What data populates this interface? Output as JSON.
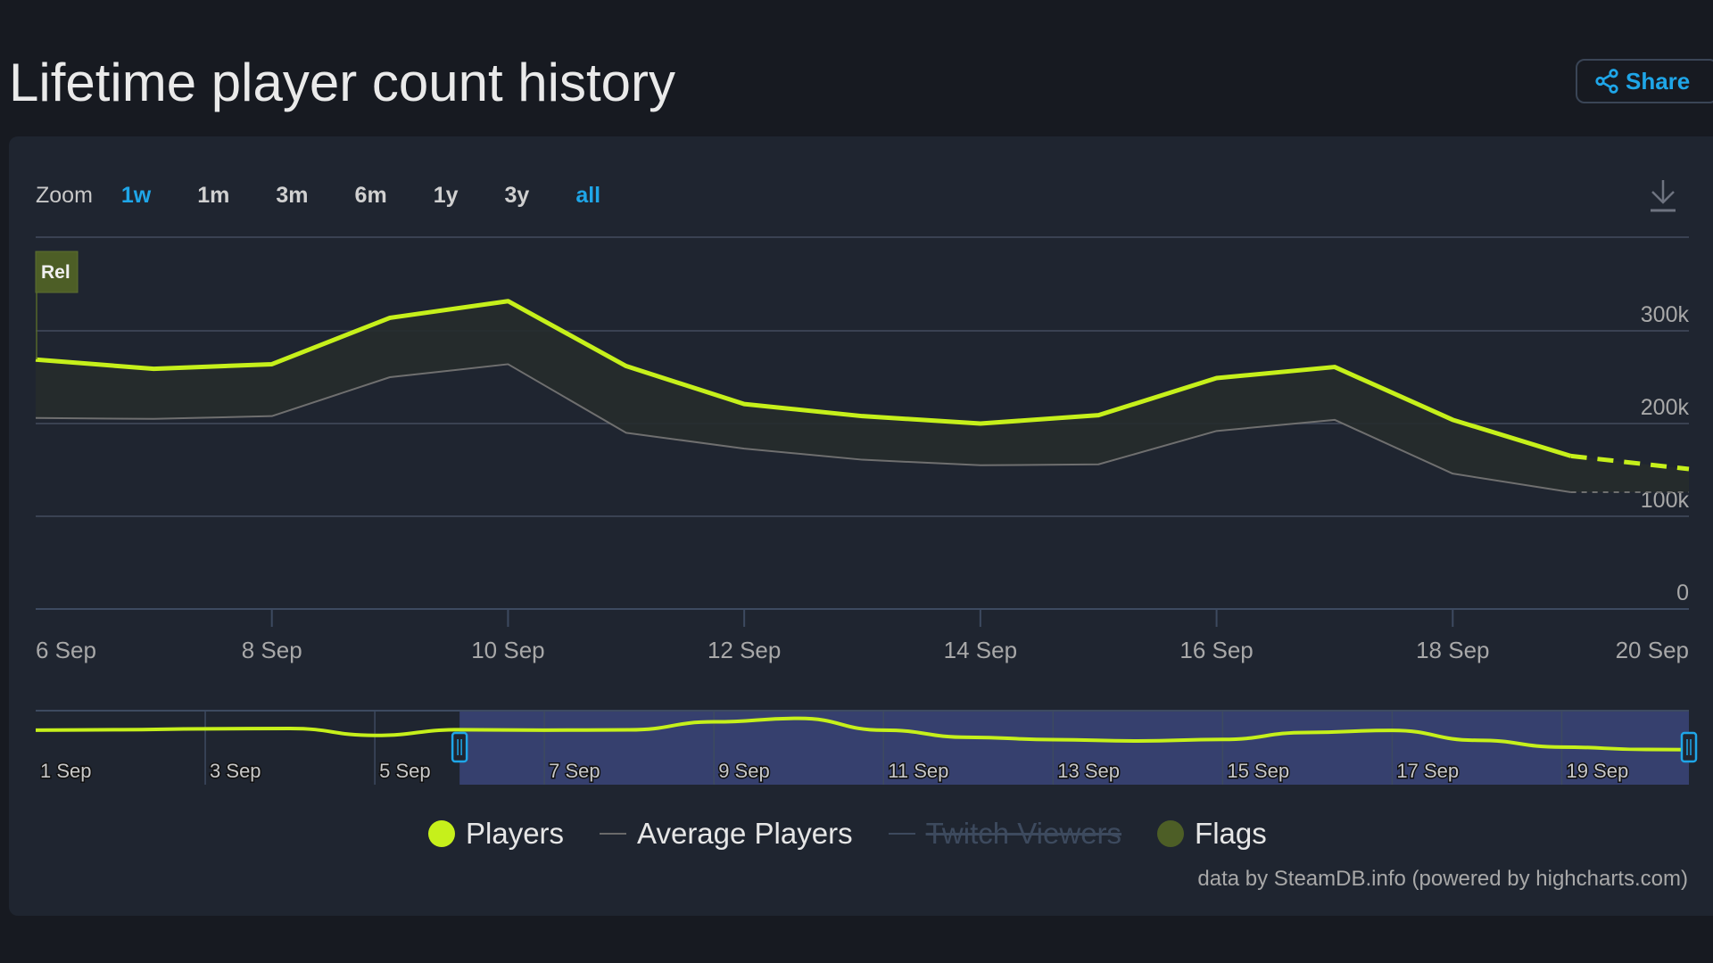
{
  "page": {
    "title": "Lifetime player count history",
    "share_label": "Share"
  },
  "toolbar": {
    "zoom_label": "Zoom",
    "zoom_options": [
      "1w",
      "1m",
      "3m",
      "6m",
      "1y",
      "3y",
      "all"
    ],
    "active_zoom": [
      "1w",
      "all"
    ]
  },
  "flag": {
    "label": "Rel",
    "date": "6 Sep"
  },
  "legend": {
    "items": [
      {
        "label": "Players",
        "symbol": "dot",
        "color": "#c6f01b",
        "hidden": false
      },
      {
        "label": "Average Players",
        "symbol": "line",
        "color": "#8a8a8a",
        "hidden": false
      },
      {
        "label": "Twitch Viewers",
        "symbol": "line",
        "color": "#3d4a5e",
        "hidden": true
      },
      {
        "label": "Flags",
        "symbol": "dot",
        "color": "#4d5e26",
        "hidden": false
      }
    ]
  },
  "credits": "data by SteamDB.info (powered by highcharts.com)",
  "colors": {
    "players": "#c6f01b",
    "average": "#7a7a7a",
    "accent": "#1fa6e8",
    "flag": "#4d5e26",
    "navigator_selection": "#36406e"
  },
  "chart_data": {
    "type": "line",
    "title": "Lifetime player count history",
    "x": [
      "6 Sep",
      "7 Sep",
      "8 Sep",
      "9 Sep",
      "10 Sep",
      "11 Sep",
      "12 Sep",
      "13 Sep",
      "14 Sep",
      "15 Sep",
      "16 Sep",
      "17 Sep",
      "18 Sep",
      "19 Sep",
      "20 Sep"
    ],
    "x_day_index": [
      6,
      7,
      8,
      9,
      10,
      11,
      12,
      13,
      14,
      15,
      16,
      17,
      18,
      19,
      20
    ],
    "series": [
      {
        "name": "Players",
        "values": [
          269000,
          259000,
          264000,
          314000,
          332000,
          262000,
          221000,
          208000,
          200000,
          209000,
          249000,
          261000,
          204000,
          165000,
          151000
        ],
        "dashed_from_index": 13
      },
      {
        "name": "Average Players",
        "values": [
          206000,
          205000,
          208000,
          250000,
          264000,
          190000,
          173000,
          161000,
          155000,
          156000,
          192000,
          204000,
          146000,
          126000,
          126000
        ],
        "dashed_from_index": 13
      }
    ],
    "xtick_labels": [
      "6 Sep",
      "8 Sep",
      "10 Sep",
      "12 Sep",
      "14 Sep",
      "16 Sep",
      "18 Sep",
      "20 Sep"
    ],
    "xtick_days": [
      6,
      8,
      10,
      12,
      14,
      16,
      18,
      20
    ],
    "ytick_labels": [
      "0",
      "100k",
      "200k",
      "300k"
    ],
    "ytick_values": [
      0,
      100000,
      200000,
      300000
    ],
    "ylim": [
      0,
      400000
    ],
    "xlabel": "",
    "ylabel": "",
    "grid": true,
    "legend_position": "bottom-center",
    "navigator": {
      "x_range_days": [
        1,
        20.5
      ],
      "selection_days": [
        6,
        20.5
      ],
      "tick_labels": [
        "1 Sep",
        "3 Sep",
        "5 Sep",
        "7 Sep",
        "9 Sep",
        "11 Sep",
        "13 Sep",
        "15 Sep",
        "17 Sep",
        "19 Sep"
      ],
      "tick_days": [
        1,
        3,
        5,
        7,
        9,
        11,
        13,
        15,
        17,
        19
      ],
      "players_days": [
        1,
        2,
        3,
        4,
        5,
        6,
        7,
        8,
        9,
        10,
        11,
        12,
        13,
        14,
        15,
        16,
        17,
        18,
        19,
        20,
        20.5
      ],
      "players_values": [
        262000,
        265000,
        270000,
        272000,
        232000,
        265000,
        262000,
        264000,
        310000,
        330000,
        262000,
        221000,
        208000,
        200000,
        209000,
        249000,
        261000,
        204000,
        165000,
        151000,
        150000
      ]
    }
  }
}
